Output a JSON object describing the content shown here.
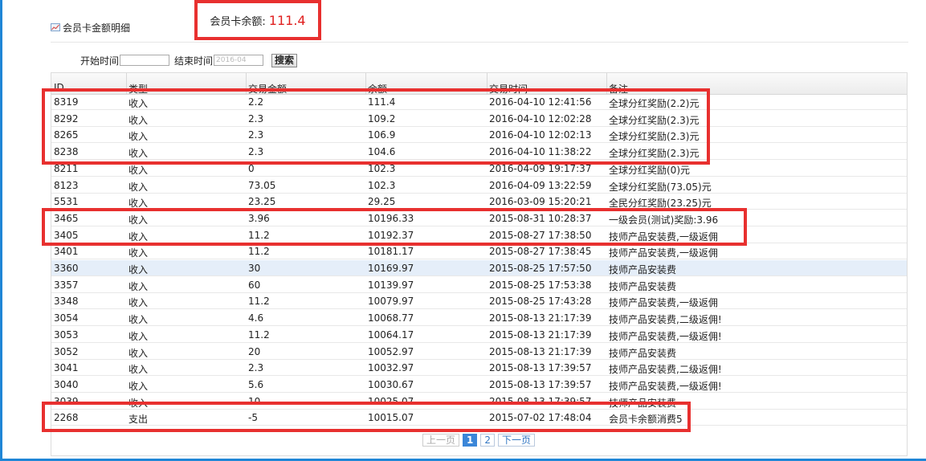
{
  "title": "会员卡金额明细",
  "balance": {
    "label": "会员卡余额:",
    "value": "111.4"
  },
  "filter": {
    "start_label": "开始时间",
    "start_value": "",
    "end_label": "结束时间",
    "end_value": "2016-04",
    "search_label": "搜索"
  },
  "table": {
    "headers": [
      "ID",
      "类型",
      "交易金额",
      "余额",
      "交易时间",
      "备注"
    ],
    "rows": [
      {
        "id": "8319",
        "type": "收入",
        "amount": "2.2",
        "balance": "111.4",
        "time": "2016-04-10 12:41:56",
        "note": "全球分红奖励(2.2)元"
      },
      {
        "id": "8292",
        "type": "收入",
        "amount": "2.3",
        "balance": "109.2",
        "time": "2016-04-10 12:02:28",
        "note": "全球分红奖励(2.3)元"
      },
      {
        "id": "8265",
        "type": "收入",
        "amount": "2.3",
        "balance": "106.9",
        "time": "2016-04-10 12:02:13",
        "note": "全球分红奖励(2.3)元"
      },
      {
        "id": "8238",
        "type": "收入",
        "amount": "2.3",
        "balance": "104.6",
        "time": "2016-04-10 11:38:22",
        "note": "全球分红奖励(2.3)元"
      },
      {
        "id": "8211",
        "type": "收入",
        "amount": "0",
        "balance": "102.3",
        "time": "2016-04-09 19:17:37",
        "note": "全球分红奖励(0)元"
      },
      {
        "id": "8123",
        "type": "收入",
        "amount": "73.05",
        "balance": "102.3",
        "time": "2016-04-09 13:22:59",
        "note": "全球分红奖励(73.05)元"
      },
      {
        "id": "5531",
        "type": "收入",
        "amount": "23.25",
        "balance": "29.25",
        "time": "2016-03-09 15:20:21",
        "note": "全民分红奖励(23.25)元"
      },
      {
        "id": "3465",
        "type": "收入",
        "amount": "3.96",
        "balance": "10196.33",
        "time": "2015-08-31 10:28:37",
        "note": "一级会员(测试)奖励:3.96"
      },
      {
        "id": "3405",
        "type": "收入",
        "amount": "11.2",
        "balance": "10192.37",
        "time": "2015-08-27 17:38:50",
        "note": "技师产品安装费,一级返佣"
      },
      {
        "id": "3401",
        "type": "收入",
        "amount": "11.2",
        "balance": "10181.17",
        "time": "2015-08-27 17:38:45",
        "note": "技师产品安装费,一级返佣"
      },
      {
        "id": "3360",
        "type": "收入",
        "amount": "30",
        "balance": "10169.97",
        "time": "2015-08-25 17:57:50",
        "note": "技师产品安装费"
      },
      {
        "id": "3357",
        "type": "收入",
        "amount": "60",
        "balance": "10139.97",
        "time": "2015-08-25 17:53:38",
        "note": "技师产品安装费"
      },
      {
        "id": "3348",
        "type": "收入",
        "amount": "11.2",
        "balance": "10079.97",
        "time": "2015-08-25 17:43:28",
        "note": "技师产品安装费,一级返佣"
      },
      {
        "id": "3054",
        "type": "收入",
        "amount": "4.6",
        "balance": "10068.77",
        "time": "2015-08-13 21:17:39",
        "note": "技师产品安装费,二级返佣!"
      },
      {
        "id": "3053",
        "type": "收入",
        "amount": "11.2",
        "balance": "10064.17",
        "time": "2015-08-13 21:17:39",
        "note": "技师产品安装费,一级返佣!"
      },
      {
        "id": "3052",
        "type": "收入",
        "amount": "20",
        "balance": "10052.97",
        "time": "2015-08-13 21:17:39",
        "note": "技师产品安装费"
      },
      {
        "id": "3041",
        "type": "收入",
        "amount": "2.3",
        "balance": "10032.97",
        "time": "2015-08-13 17:39:57",
        "note": "技师产品安装费,二级返佣!"
      },
      {
        "id": "3040",
        "type": "收入",
        "amount": "5.6",
        "balance": "10030.67",
        "time": "2015-08-13 17:39:57",
        "note": "技师产品安装费,一级返佣!"
      },
      {
        "id": "3039",
        "type": "收入",
        "amount": "10",
        "balance": "10025.07",
        "time": "2015-08-13 17:39:57",
        "note": "技师产品安装费"
      },
      {
        "id": "2268",
        "type": "支出",
        "amount": "-5",
        "balance": "10015.07",
        "time": "2015-07-02 17:48:04",
        "note": "会员卡余额消费5"
      }
    ]
  },
  "pagination": {
    "prev": "上一页",
    "pages": [
      "1",
      "2"
    ],
    "current": "1",
    "next": "下一页"
  },
  "colors": {
    "annotation_red": "#e8302f",
    "balance_red": "#e0201f",
    "row_highlight": "#e5eef9",
    "pager_current": "#3b86d8"
  }
}
